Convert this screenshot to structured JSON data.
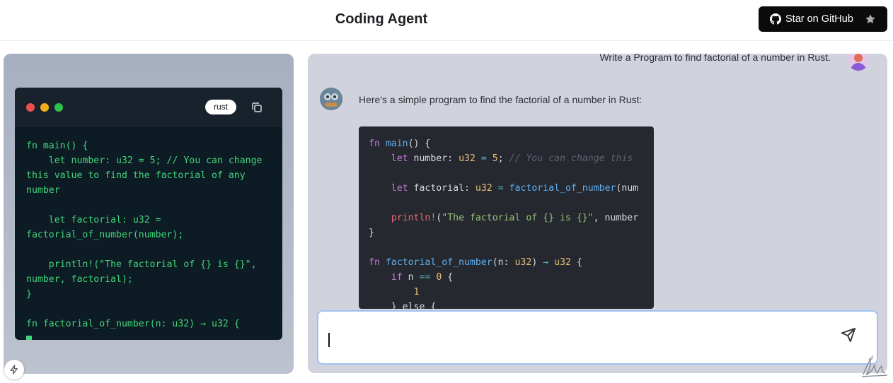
{
  "header": {
    "title": "Coding Agent",
    "github_button_label": "Star on GitHub"
  },
  "preview": {
    "language": "rust",
    "code": "fn main() {\n    let number: u32 = 5; // You can change this value to find the factorial of any number\n\n    let factorial: u32 = factorial_of_number(number);\n\n    println!(\"The factorial of {} is {}\", number, factorial);\n}\n\nfn factorial_of_number(n: u32) → u32 {"
  },
  "chat": {
    "user_message": "Write a Program to find factorial of a number in Rust.",
    "assistant_message": "Here's a simple program to find the factorial of a number in Rust:",
    "code_lines": {
      "l1_fn": "fn",
      "l1_name": "main",
      "l1_rest": "() {",
      "l2_let": "let",
      "l2_var": "number:",
      "l2_type": "u32",
      "l2_eq": "=",
      "l2_num": "5",
      "l2_semi": ";",
      "l2_comment": "// You can change this",
      "l3_let": "let",
      "l3_var": "factorial:",
      "l3_type": "u32",
      "l3_eq": "=",
      "l3_call": "factorial_of_number",
      "l3_arg": "(num",
      "l4_macro": "println!",
      "l4_open": "(",
      "l4_str": "\"The factorial of {} is {}\"",
      "l4_rest": ", number",
      "l5_close": "}",
      "l6_fn": "fn",
      "l6_name": "factorial_of_number",
      "l6_params": "(n:",
      "l6_ptype": "u32",
      "l6_close": ")",
      "l6_arrow": "→",
      "l6_rtype": "u32",
      "l6_brace": "{",
      "l7_if": "if",
      "l7_cond": "n",
      "l7_op": "==",
      "l7_num": "0",
      "l7_brace": "{",
      "l8_num": "1",
      "l9_else": "} else {"
    },
    "input_value": "",
    "input_placeholder": ""
  },
  "icons": {
    "github": "github-icon",
    "star": "star-icon",
    "copy": "copy-icon",
    "send": "send-icon",
    "bolt": "bolt-icon"
  },
  "colors": {
    "preview_code": "#41d67b",
    "github_button": "#0b0b0c",
    "chat_background": "#d0d2dd",
    "input_border": "#9fc3f0"
  }
}
